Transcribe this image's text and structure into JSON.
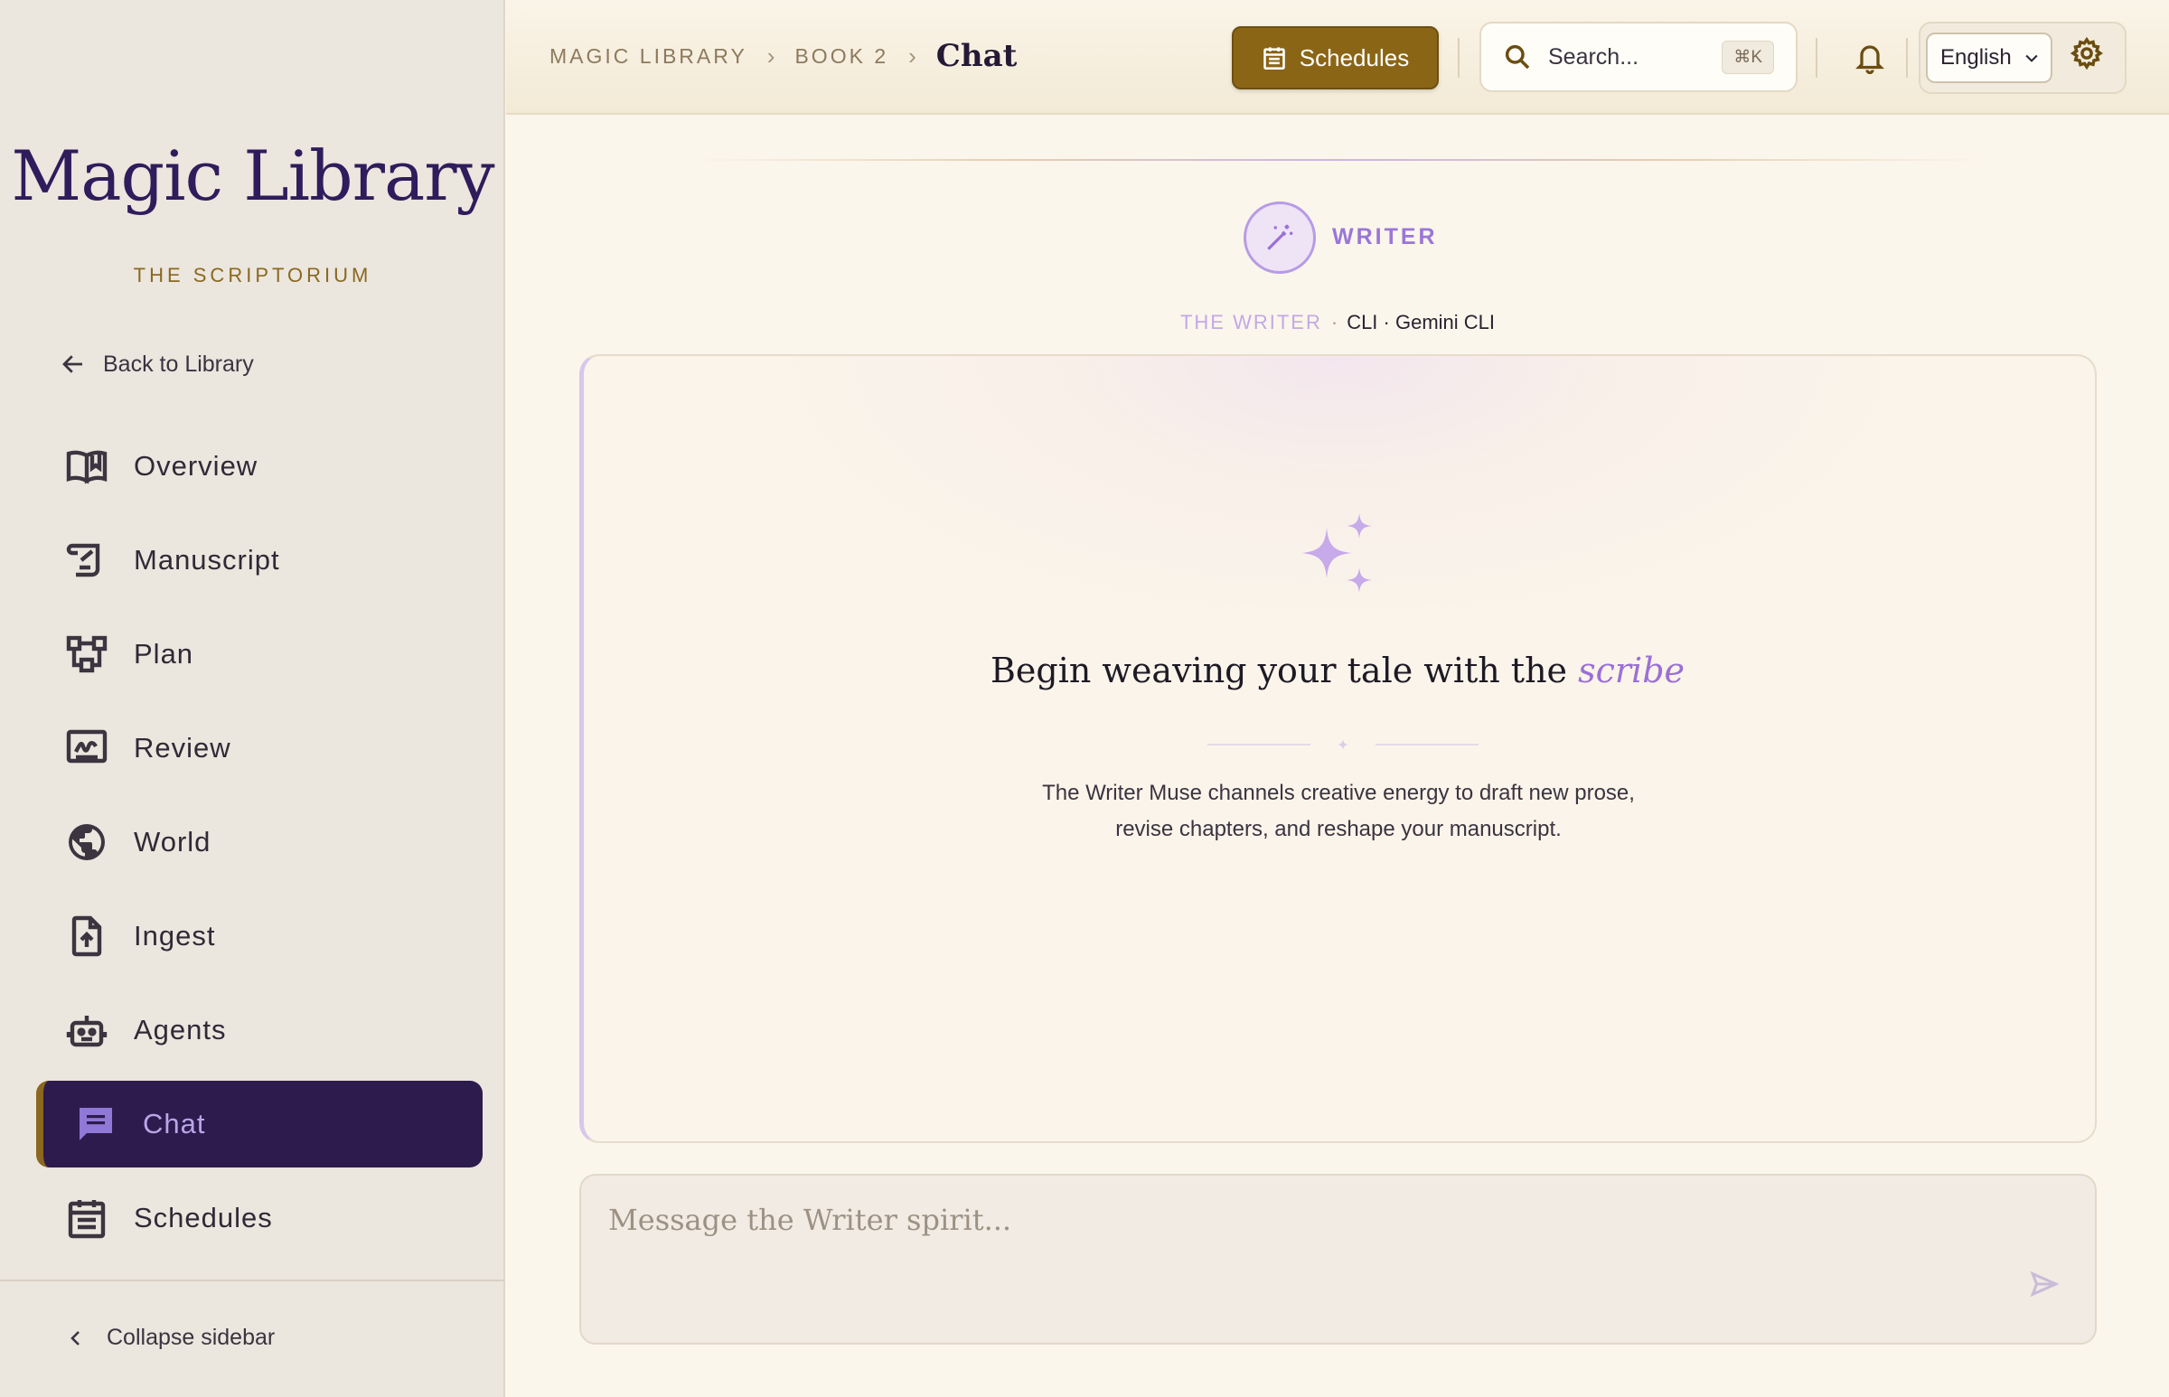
{
  "sidebar": {
    "logo": "Magic Library",
    "subtitle": "THE SCRIPTORIUM",
    "back_label": "Back to Library",
    "items": [
      {
        "label": "Overview",
        "icon": "book-open-icon"
      },
      {
        "label": "Manuscript",
        "icon": "scroll-icon"
      },
      {
        "label": "Plan",
        "icon": "hierarchy-icon"
      },
      {
        "label": "Review",
        "icon": "signature-icon"
      },
      {
        "label": "World",
        "icon": "globe-icon"
      },
      {
        "label": "Ingest",
        "icon": "file-upload-icon"
      },
      {
        "label": "Agents",
        "icon": "robot-icon"
      },
      {
        "label": "Chat",
        "icon": "chat-icon",
        "active": true
      },
      {
        "label": "Schedules",
        "icon": "calendar-icon"
      }
    ],
    "collapse_label": "Collapse sidebar"
  },
  "header": {
    "breadcrumb": [
      "MAGIC LIBRARY",
      "BOOK 2",
      "Chat"
    ],
    "schedules_label": "Schedules",
    "search_placeholder": "Search...",
    "search_shortcut": "⌘K",
    "language": "English"
  },
  "agent": {
    "label": "WRITER",
    "role": "THE WRITER",
    "engine": "CLI · Gemini CLI"
  },
  "empty_state": {
    "title_prefix": "Begin weaving your tale with the ",
    "title_accent": "scribe",
    "description": "The Writer Muse channels creative energy to draft new prose, revise chapters, and reshape your manuscript."
  },
  "composer": {
    "placeholder": "Message the Writer spirit..."
  },
  "colors": {
    "accent_gold": "#8b6516",
    "active_nav": "#2e1b4d",
    "accent_purple": "#9a70d6"
  }
}
